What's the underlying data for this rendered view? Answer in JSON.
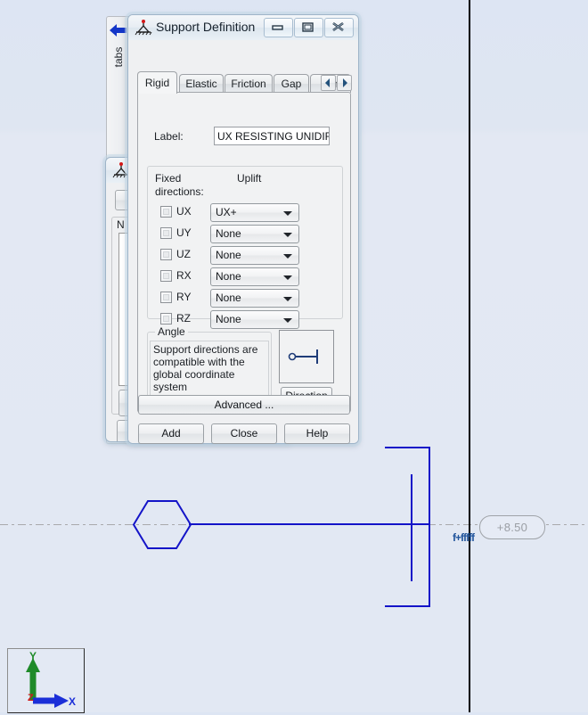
{
  "background_canvas": {
    "level_tag": "+8.50",
    "node_label": "f+fffff",
    "axis_triad": {
      "y_label": "Y",
      "x_label": "X",
      "z_label": "Z"
    }
  },
  "tabs_strip": {
    "label": "tabs",
    "arrow_icon": "arrow-left-icon"
  },
  "background_window": {
    "icon": "support-icon",
    "title": ""
  },
  "support_dialog": {
    "icon": "support-icon",
    "title": "Support Definition",
    "window_buttons": {
      "minimize": "minimize-icon",
      "maximize": "maximize-icon",
      "close": "close-icon"
    },
    "tabs": [
      {
        "label": "Rigid",
        "active": true
      },
      {
        "label": "Elastic",
        "active": false
      },
      {
        "label": "Friction",
        "active": false
      },
      {
        "label": "Gap",
        "active": false
      },
      {
        "label": "Non",
        "active": false
      }
    ],
    "tab_nav": {
      "prev": "chevron-left-icon",
      "next": "chevron-right-icon"
    },
    "label_field": {
      "caption": "Label:",
      "value": "UX RESISTING UNIDIF",
      "placeholder": ""
    },
    "fixed_directions": {
      "caption_line1": "Fixed",
      "caption_line2": "directions:",
      "uplift_caption": "Uplift",
      "rows": [
        {
          "name": "UX",
          "checked": false,
          "uplift": "UX+"
        },
        {
          "name": "UY",
          "checked": false,
          "uplift": "None"
        },
        {
          "name": "UZ",
          "checked": false,
          "uplift": "None"
        },
        {
          "name": "RX",
          "checked": false,
          "uplift": "None"
        },
        {
          "name": "RY",
          "checked": false,
          "uplift": "None"
        },
        {
          "name": "RZ",
          "checked": false,
          "uplift": "None"
        }
      ]
    },
    "angle": {
      "legend": "Angle",
      "text": "Support directions are compatible with the global coordinate system",
      "direction_button": "Direction",
      "preview_icon": "support-direction-icon"
    },
    "buttons": {
      "advanced": "Advanced ...",
      "add": "Add",
      "close": "Close",
      "help": "Help"
    }
  }
}
